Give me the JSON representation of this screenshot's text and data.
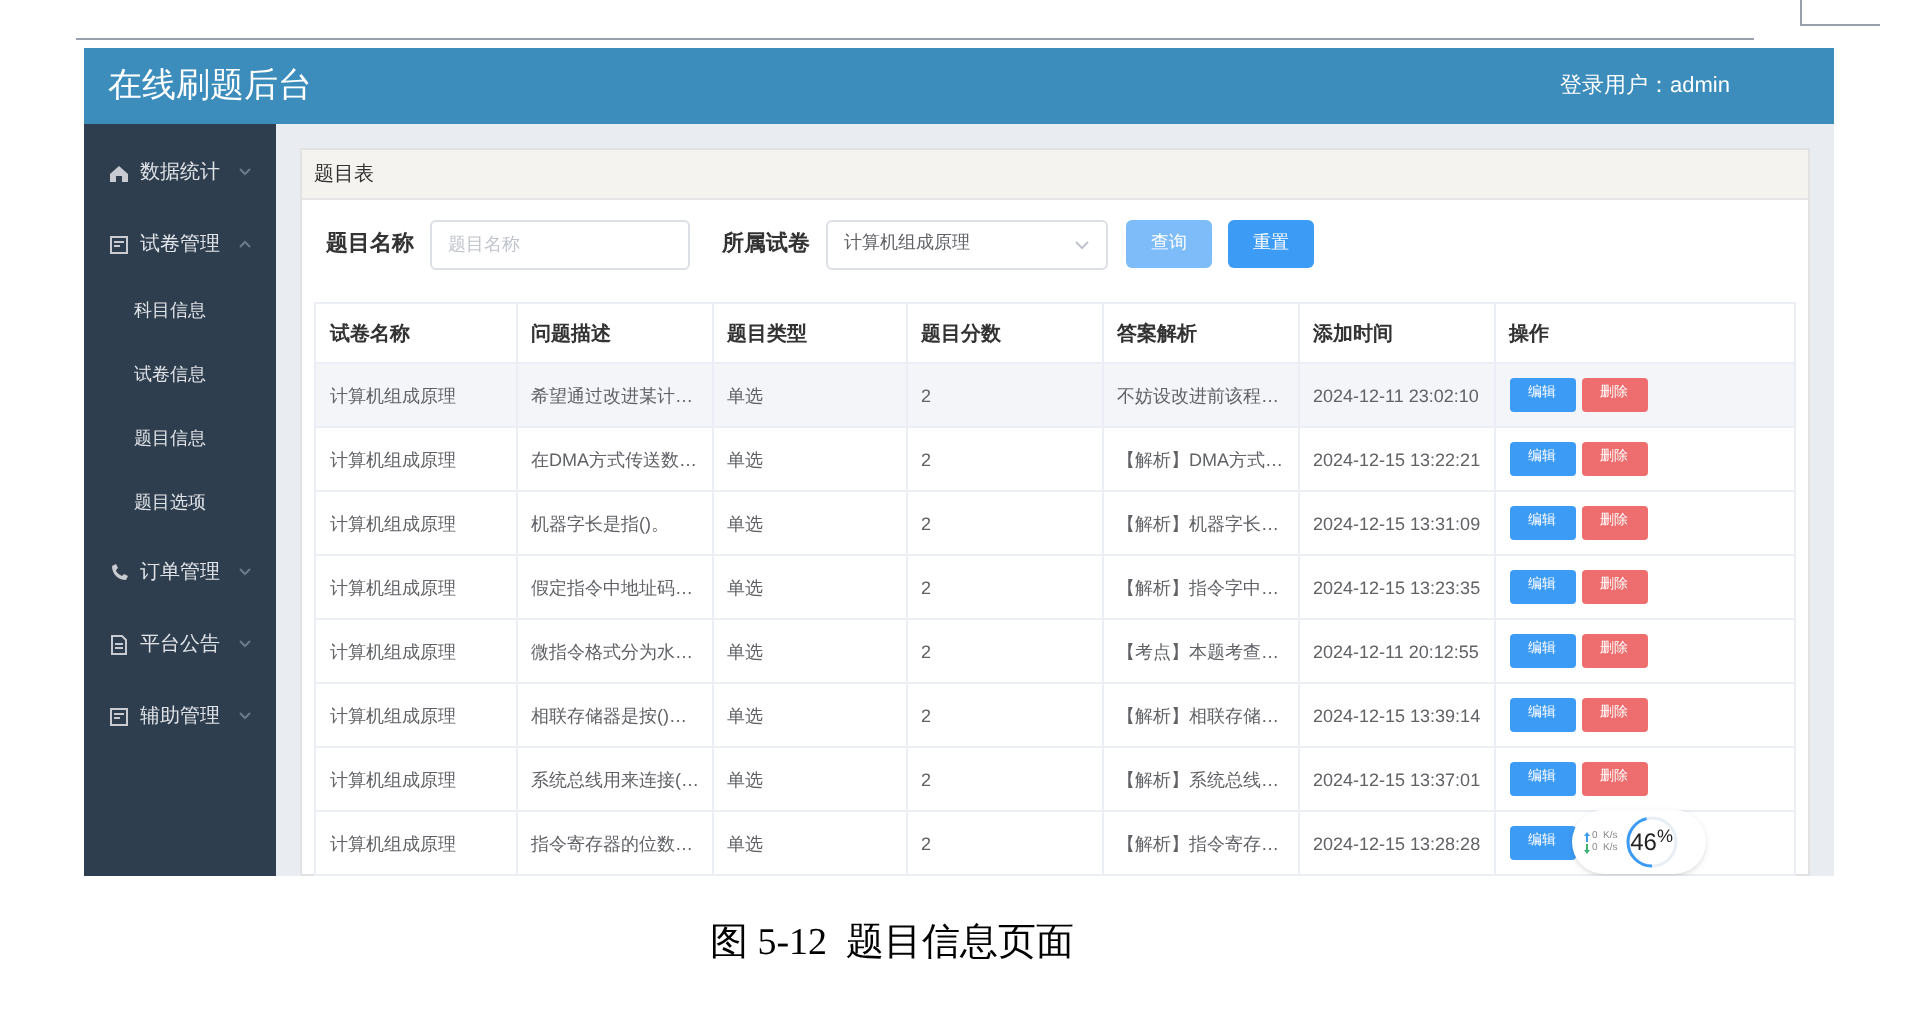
{
  "header": {
    "title": "在线刷题后台",
    "user_label": "登录用户：admin"
  },
  "sidebar": {
    "items": [
      {
        "label": "数据统计",
        "expanded": false
      },
      {
        "label": "试卷管理",
        "expanded": true,
        "children": [
          {
            "label": "科目信息"
          },
          {
            "label": "试卷信息"
          },
          {
            "label": "题目信息"
          },
          {
            "label": "题目选项"
          }
        ]
      },
      {
        "label": "订单管理",
        "expanded": false
      },
      {
        "label": "平台公告",
        "expanded": false
      },
      {
        "label": "辅助管理",
        "expanded": false
      }
    ]
  },
  "card": {
    "title": "题目表"
  },
  "filters": {
    "name_label": "题目名称",
    "name_placeholder": "题目名称",
    "paper_label": "所属试卷",
    "paper_value": "计算机组成原理",
    "buttons": [
      {
        "label": "查询",
        "disabled": true
      },
      {
        "label": "重置",
        "disabled": false
      }
    ]
  },
  "table": {
    "columns": [
      "试卷名称",
      "问题描述",
      "题目类型",
      "题目分数",
      "答案解析",
      "添加时间",
      "操作"
    ],
    "rows": [
      {
        "highlighted": true,
        "cells": [
          "计算机组成原理",
          "希望通过改进某计…",
          "单选",
          "2",
          "不妨设改进前该程…",
          "2024-12-11 23:02:10"
        ],
        "actions": [
          "编辑",
          "删除"
        ]
      },
      {
        "highlighted": false,
        "cells": [
          "计算机组成原理",
          "在DMA方式传送数…",
          "单选",
          "2",
          "【解析】DMA方式…",
          "2024-12-15 13:22:21"
        ],
        "actions": [
          "编辑",
          "删除"
        ]
      },
      {
        "highlighted": false,
        "cells": [
          "计算机组成原理",
          "机器字长是指()。",
          "单选",
          "2",
          "【解析】机器字长…",
          "2024-12-15 13:31:09"
        ],
        "actions": [
          "编辑",
          "删除"
        ]
      },
      {
        "highlighted": false,
        "cells": [
          "计算机组成原理",
          "假定指令中地址码…",
          "单选",
          "2",
          "【解析】指令字中…",
          "2024-12-15 13:23:35"
        ],
        "actions": [
          "编辑",
          "删除"
        ]
      },
      {
        "highlighted": false,
        "cells": [
          "计算机组成原理",
          "微指令格式分为水…",
          "单选",
          "2",
          "【考点】本题考查…",
          "2024-12-11 20:12:55"
        ],
        "actions": [
          "编辑",
          "删除"
        ]
      },
      {
        "highlighted": false,
        "cells": [
          "计算机组成原理",
          "相联存储器是按()…",
          "单选",
          "2",
          "【解析】相联存储…",
          "2024-12-15 13:39:14"
        ],
        "actions": [
          "编辑",
          "删除"
        ]
      },
      {
        "highlighted": false,
        "cells": [
          "计算机组成原理",
          "系统总线用来连接(…",
          "单选",
          "2",
          "【解析】系统总线…",
          "2024-12-15 13:37:01"
        ],
        "actions": [
          "编辑",
          "删除"
        ]
      },
      {
        "highlighted": false,
        "cells": [
          "计算机组成原理",
          "指令寄存器的位数…",
          "单选",
          "2",
          "【解析】指令寄存…",
          "2024-12-15 13:28:28"
        ],
        "actions": [
          "编辑"
        ]
      }
    ]
  },
  "speed_widget": {
    "upload": "0  K/s",
    "download": "0  K/s",
    "percent": "46",
    "percent_sign": "%",
    "level": 0.46
  },
  "caption": "图 5-12  题目信息页面"
}
